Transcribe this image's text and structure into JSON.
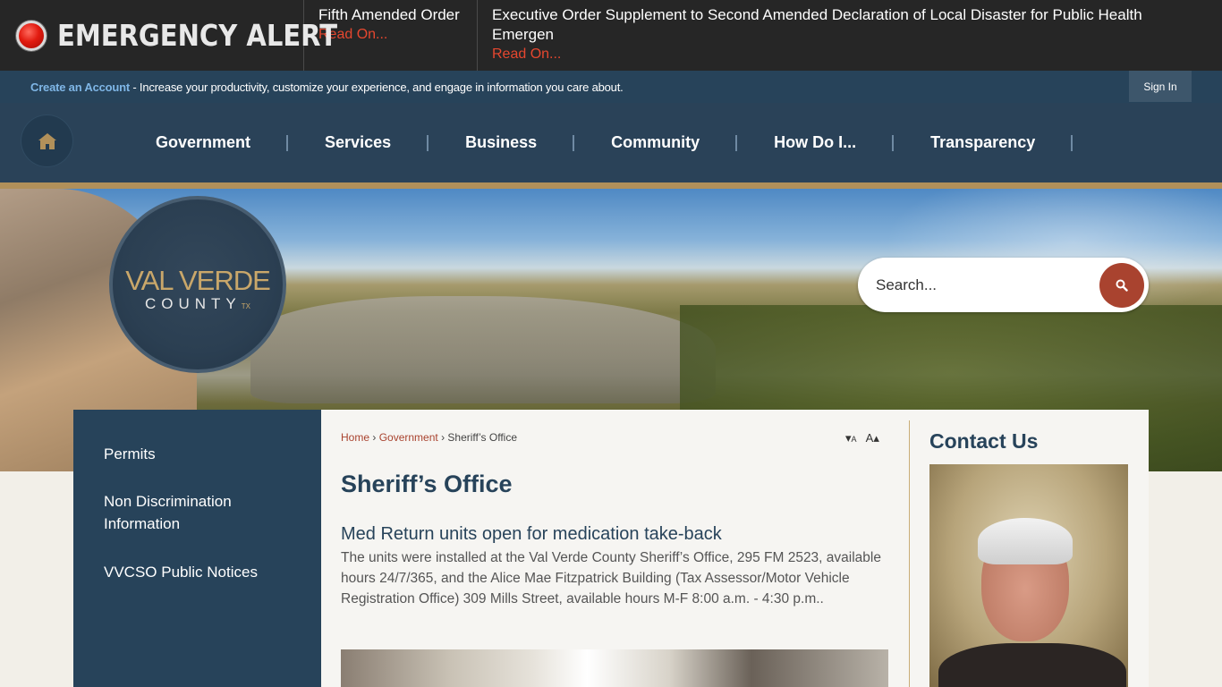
{
  "alert": {
    "label": "EMERGENCY ALERT",
    "items": [
      {
        "title": "Fifth Amended Order",
        "more": "Read On..."
      },
      {
        "title": "Executive Order Supplement to Second Amended Declaration of Local Disaster for Public Health Emergen",
        "more": "Read On..."
      }
    ]
  },
  "account": {
    "link": "Create an Account",
    "text": " - Increase your productivity, customize your experience, and engage in information you care about.",
    "signin": "Sign In"
  },
  "nav": {
    "home_icon": "home-icon",
    "items": [
      "Government",
      "Services",
      "Business",
      "Community",
      "How Do I...",
      "Transparency"
    ]
  },
  "logo": {
    "line1": "VAL VERDE",
    "line2": "COUNTY",
    "tx": "TX"
  },
  "search": {
    "placeholder": "Search...",
    "icon": "search-icon"
  },
  "sidebar": {
    "items": [
      "Permits",
      "Non Discrimination Information",
      "VVCSO Public Notices"
    ]
  },
  "breadcrumb": {
    "home": "Home",
    "section": "Government",
    "current": "Sheriff’s Office",
    "sep": "›"
  },
  "text_resize": {
    "smaller": "A",
    "larger": "A"
  },
  "main": {
    "title": "Sheriff’s Office",
    "news_title": "Med Return units open for medication take-back",
    "news_body": "The units were installed at the Val Verde County Sheriff’s Office, 295 FM 2523, available hours 24/7/365,  and the Alice Mae Fitzpatrick Building (Tax Assessor/Motor Vehicle Registration Office) 309 Mills Street, available hours M-F 8:00 a.m. - 4:30 p.m.."
  },
  "contact": {
    "title": "Contact Us"
  },
  "colors": {
    "navy": "#27435a",
    "gold": "#b1905a",
    "accent_red": "#a9432f",
    "alert_bg": "#262626",
    "link_blue": "#7fb6e6"
  }
}
